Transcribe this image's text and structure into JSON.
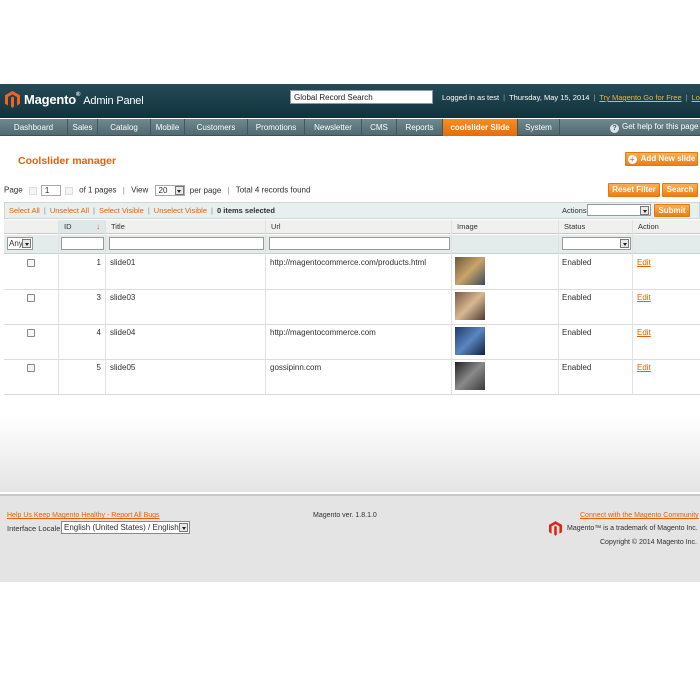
{
  "header": {
    "logo_text": "Magento",
    "logo_sub": "Admin Panel",
    "search_value": "Global Record Search",
    "logged_in": "Logged in as test",
    "date": "Thursday, May 15, 2014",
    "try_link": "Try Magento Go for Free",
    "logout": "Log Out"
  },
  "nav": {
    "items": [
      "Dashboard",
      "Sales",
      "Catalog",
      "Mobile",
      "Customers",
      "Promotions",
      "Newsletter",
      "CMS",
      "Reports",
      "coolslider Slide",
      "System"
    ],
    "active_index": 9,
    "help": "Get help for this page"
  },
  "page": {
    "title": "Coolslider manager",
    "add_button": "Add New slide"
  },
  "pager": {
    "page_label": "Page",
    "page_value": "1",
    "of_pages": "of 1 pages",
    "view_label": "View",
    "view_value": "20",
    "per_page": "per page",
    "total": "Total 4 records found",
    "reset_button": "Reset Filter",
    "search_button": "Search"
  },
  "massaction": {
    "select_all": "Select All",
    "unselect_all": "Unselect All",
    "select_visible": "Select Visible",
    "unselect_visible": "Unselect Visible",
    "selected": "0 items selected",
    "actions_label": "Actions",
    "submit_button": "Submit"
  },
  "grid": {
    "columns": [
      "ID",
      "Title",
      "Url",
      "Image",
      "Status",
      "Action"
    ],
    "any_filter": "Any",
    "rows": [
      {
        "id": "1",
        "title": "slide01",
        "url": "http://magentocommerce.com/products.html",
        "status": "Enabled",
        "action": "Edit",
        "thumb_colors": [
          "#6b5a3a",
          "#c9a46a",
          "#3b4a5a"
        ]
      },
      {
        "id": "3",
        "title": "slide03",
        "url": "",
        "status": "Enabled",
        "action": "Edit",
        "thumb_colors": [
          "#7a5a44",
          "#d8b893",
          "#4a3a30"
        ]
      },
      {
        "id": "4",
        "title": "slide04",
        "url": "http://magentocommerce.com",
        "status": "Enabled",
        "action": "Edit",
        "thumb_colors": [
          "#1f3a6a",
          "#5a86c0",
          "#102040"
        ]
      },
      {
        "id": "5",
        "title": "slide05",
        "url": "gossipinn.com",
        "status": "Enabled",
        "action": "Edit",
        "thumb_colors": [
          "#222222",
          "#8a8a8a",
          "#3a3a3a"
        ]
      }
    ]
  },
  "footer": {
    "left_link": "Help Us Keep Magento Healthy - Report All Bugs",
    "locale_label": "Interface Locale:",
    "locale_value": "English (United States) / English",
    "version": "Magento ver. 1.8.1.0",
    "right_link": "Connect with the Magento Community",
    "trademark": "Magento™ is a trademark of Magento Inc.",
    "copyright": "Copyright © 2014 Magento Inc."
  },
  "colors": {
    "accent": "#eb5e00",
    "header_bg": "#163a45",
    "nav_bg": "#5f787f"
  }
}
